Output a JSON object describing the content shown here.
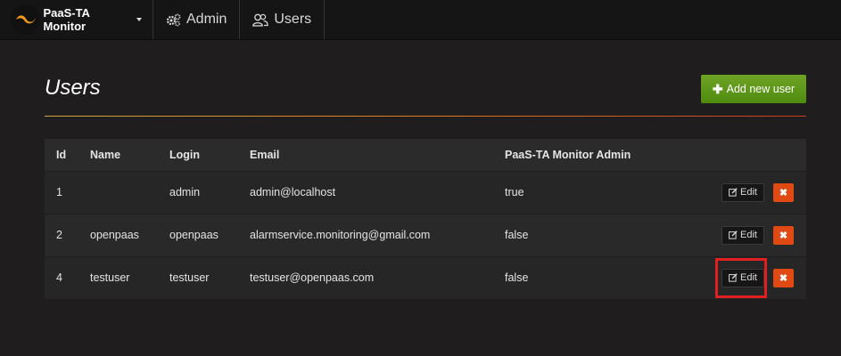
{
  "nav": {
    "brand_label": "PaaS-TA Monitor",
    "items": [
      {
        "label": "Admin",
        "icon": "cogs-icon"
      },
      {
        "label": "Users",
        "icon": "users-icon"
      }
    ]
  },
  "page": {
    "title": "Users",
    "add_button_label": "Add new user"
  },
  "table": {
    "headers": [
      "Id",
      "Name",
      "Login",
      "Email",
      "PaaS-TA Monitor Admin"
    ],
    "edit_label": "Edit",
    "rows": [
      {
        "id": "1",
        "name": "",
        "login": "admin",
        "email": "admin@localhost",
        "admin": "true"
      },
      {
        "id": "2",
        "name": "openpaas",
        "login": "openpaas",
        "email": "alarmservice.monitoring@gmail.com",
        "admin": "false"
      },
      {
        "id": "4",
        "name": "testuser",
        "login": "testuser",
        "email": "testuser@openpaas.com",
        "admin": "false"
      }
    ]
  },
  "colors": {
    "accent_green": "#5a9a18",
    "delete_orange": "#e04a12",
    "highlight_red": "#e02020"
  }
}
